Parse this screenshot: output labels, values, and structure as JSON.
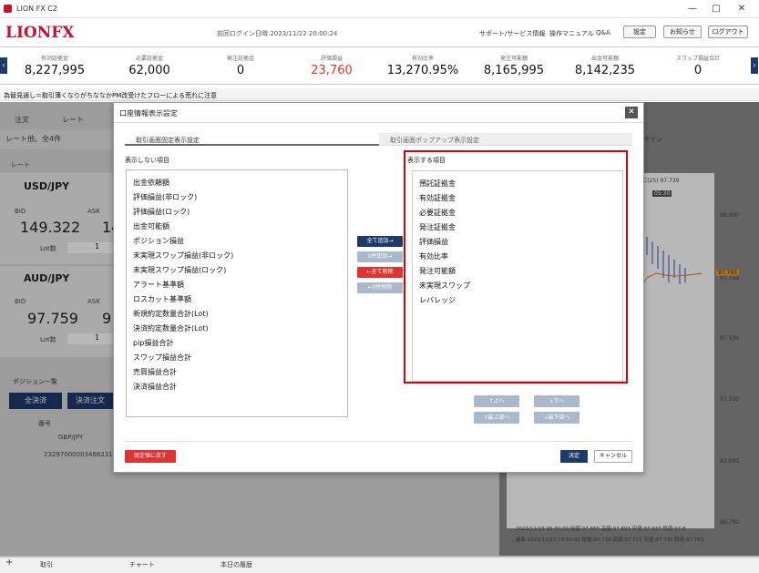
{
  "window": {
    "title": "LION FX C2"
  },
  "header": {
    "logo": "LIONFX",
    "last_login": "前回ログイン日時:2023/11/22 20:00:24",
    "links": [
      "サポート/サービス情報",
      "操作マニュアル",
      "Q&A"
    ],
    "buttons": [
      "設定",
      "お知らせ",
      "ログアウト"
    ]
  },
  "summary": [
    {
      "label": "有効証拠金",
      "value": "8,227,995"
    },
    {
      "label": "必要証拠金",
      "value": "62,000"
    },
    {
      "label": "発注証拠金",
      "value": "0"
    },
    {
      "label": "評価損益",
      "value": "23,760"
    },
    {
      "label": "有効比率",
      "value": "13,270.95%"
    },
    {
      "label": "発注可能額",
      "value": "8,165,995"
    },
    {
      "label": "出金可能額",
      "value": "8,142,235"
    },
    {
      "label": "スワップ損益合計",
      "value": "0"
    }
  ],
  "news": "為替見通し＝取引薄くなりがちななかPM改受けたフローによる荒れに注意",
  "background": {
    "menu": [
      "注文",
      "レート"
    ],
    "rate_title": "レート他、全4件",
    "rate_label": "レート",
    "pairs": [
      {
        "name": "USD/JPY",
        "bid_label": "BID",
        "ask_label": "ASK",
        "bid": "149.322",
        "ask": "14",
        "lot_label": "Lot数",
        "lot": "1"
      },
      {
        "name": "AUD/JPY",
        "bid_label": "BID",
        "ask_label": "ASK",
        "bid": "97.759",
        "ask": "9",
        "lot_label": "Lot数",
        "lot": "1"
      }
    ],
    "position_title": "ポジション一覧",
    "settle_all": "全決済",
    "settle_order": "決済注文",
    "col_number": "番号",
    "pos_pair": "GBP/JPY",
    "pos_id": "23297000003466231",
    "chart_label": "C(25) 97.739",
    "chart_time": "05:30",
    "chart_price": "97.763",
    "chart_axis": [
      "98.000",
      "97.750",
      "97.500",
      "97.250",
      "97.000",
      "96.750"
    ],
    "chart_footer1": "2023/11/23 05:30:00 始値:97.865 高値:97.893 安値:97.833 終値:97.8",
    "chart_footer2": "最新 2023/11/23 13:30:00 始値:97.738 高値:97.777 安値:97.735 終値:97.763",
    "chart_tab": "サイン"
  },
  "bottom_tabs": [
    "取引",
    "チャート",
    "本日の履歴"
  ],
  "dialog": {
    "title": "口座情報表示設定",
    "tabs": [
      "取引画面固定表示設定",
      "取引画面ポップアップ表示設定"
    ],
    "hidden_label": "表示しない項目",
    "shown_label": "表示する項目",
    "hidden_items": [
      "出金依頼額",
      "評価損益(非ロック)",
      "評価損益(ロック)",
      "出金可能額",
      "ポジション損益",
      "未実現スワップ損益(非ロック)",
      "未実現スワップ損益(ロック)",
      "アラート基準額",
      "ロスカット基準額",
      "新規約定数量合計(Lot)",
      "決済約定数量合計(Lot)",
      "pip損益合計",
      "スワップ損益合計",
      "売買損益合計",
      "決済損益合計"
    ],
    "shown_items": [
      "預託証拠金",
      "有効証拠金",
      "必要証拠金",
      "発注証拠金",
      "評価損益",
      "有効比率",
      "発注可能額",
      "未実現スワップ",
      "レバレッジ"
    ],
    "move_buttons": [
      "全て追加→",
      "0件追加→",
      "←全て削除",
      "←0件削除"
    ],
    "order_buttons": [
      "↑上へ",
      "↓下へ",
      "↑最上部へ",
      "↓最下部へ"
    ],
    "reset_label": "既定値に戻す",
    "ok_label": "決定",
    "cancel_label": "キャンセル"
  },
  "colors": {
    "brand": "#c8102e",
    "navy": "#1d3a6b",
    "highlight": "#dd0000",
    "red_button": "#dd3333"
  }
}
